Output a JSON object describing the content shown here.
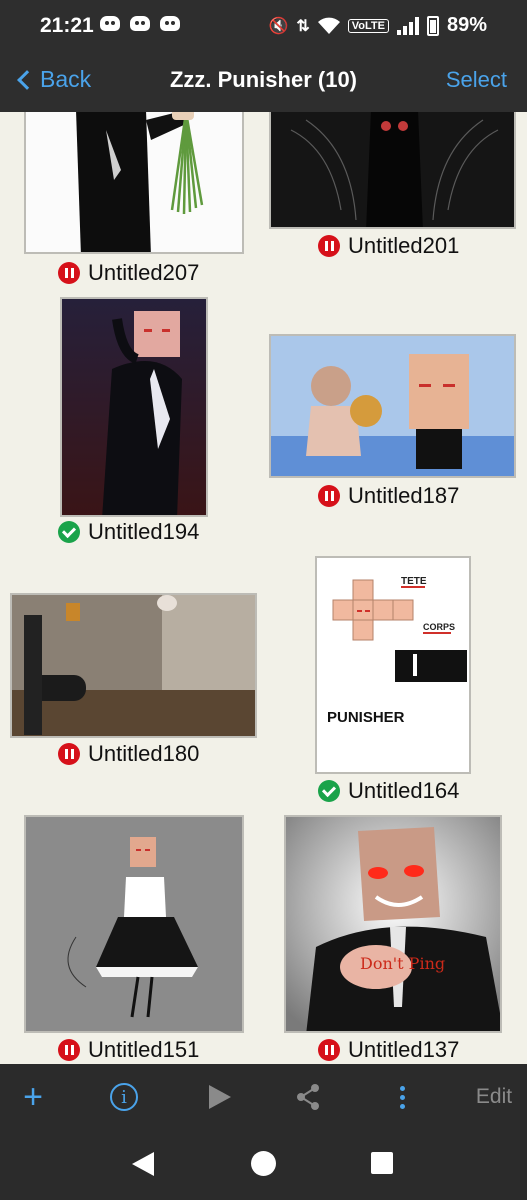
{
  "status_bar": {
    "time": "21:21",
    "battery": "89%",
    "network_badge": "VoLTE",
    "left_icons": [
      "discord-icon",
      "discord-icon",
      "discord-icon"
    ],
    "right_icons": [
      "mute-icon",
      "data-arrows-icon",
      "wifi-icon",
      "signal-icon",
      "battery-icon"
    ]
  },
  "nav": {
    "back_label": "Back",
    "title": "Zzz. Punisher (10)",
    "select_label": "Select"
  },
  "gallery": {
    "items": [
      {
        "label": "Untitled207",
        "status": "paused"
      },
      {
        "label": "Untitled201",
        "status": "paused"
      },
      {
        "label": "Untitled194",
        "status": "synced"
      },
      {
        "label": "Untitled187",
        "status": "paused"
      },
      {
        "label": "Untitled180",
        "status": "paused"
      },
      {
        "label": "Untitled164",
        "status": "synced"
      },
      {
        "label": "Untitled151",
        "status": "paused"
      },
      {
        "label": "Untitled137",
        "status": "paused"
      }
    ],
    "artwork_text": {
      "sheet_title": "PUNISHER",
      "sheet_head_label": "TETE",
      "sheet_body_label": "CORPS",
      "drawing_note": "Don't Ping"
    }
  },
  "toolbar": {
    "icons": [
      "plus-icon",
      "info-icon",
      "play-icon",
      "share-icon",
      "more-vertical-icon"
    ],
    "edit_label": "Edit"
  },
  "colors": {
    "accent": "#4aa3ea",
    "paused": "#d6111a",
    "synced": "#1aa34a",
    "bar_background": "#2e2e2e",
    "page_background": "#f2f1e8"
  }
}
